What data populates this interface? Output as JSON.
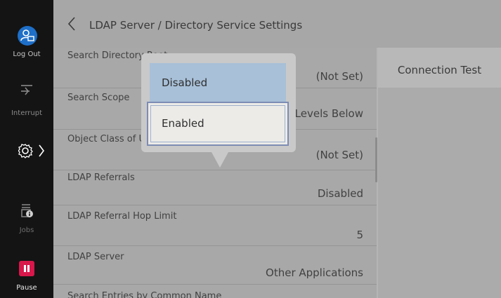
{
  "sidebar": {
    "logout_label": "Log Out",
    "interrupt_label": "Interrupt",
    "jobs_label": "Jobs",
    "pause_label": "Pause",
    "pause_color": "#d8174b",
    "logout_icon_color": "#1e6fc8"
  },
  "header": {
    "title": "LDAP Server / Directory Service Settings"
  },
  "settings": [
    {
      "label": "Search Directory Root",
      "value": "(Not Set)"
    },
    {
      "label": "Search Scope",
      "value": "All Levels Below"
    },
    {
      "label": "Object Class of Users",
      "value": "(Not Set)"
    },
    {
      "label": "LDAP Referrals",
      "value": "Disabled"
    },
    {
      "label": "LDAP Referral Hop Limit",
      "value": "5"
    },
    {
      "label": "LDAP Server",
      "value": "Other Applications"
    },
    {
      "label": "Search Entries by Common Name",
      "value": ""
    }
  ],
  "right_panel": {
    "connection_test_label": "Connection Test"
  },
  "popup": {
    "options": [
      "Disabled",
      "Enabled"
    ],
    "highlighted": "Disabled",
    "focused": "Enabled"
  }
}
